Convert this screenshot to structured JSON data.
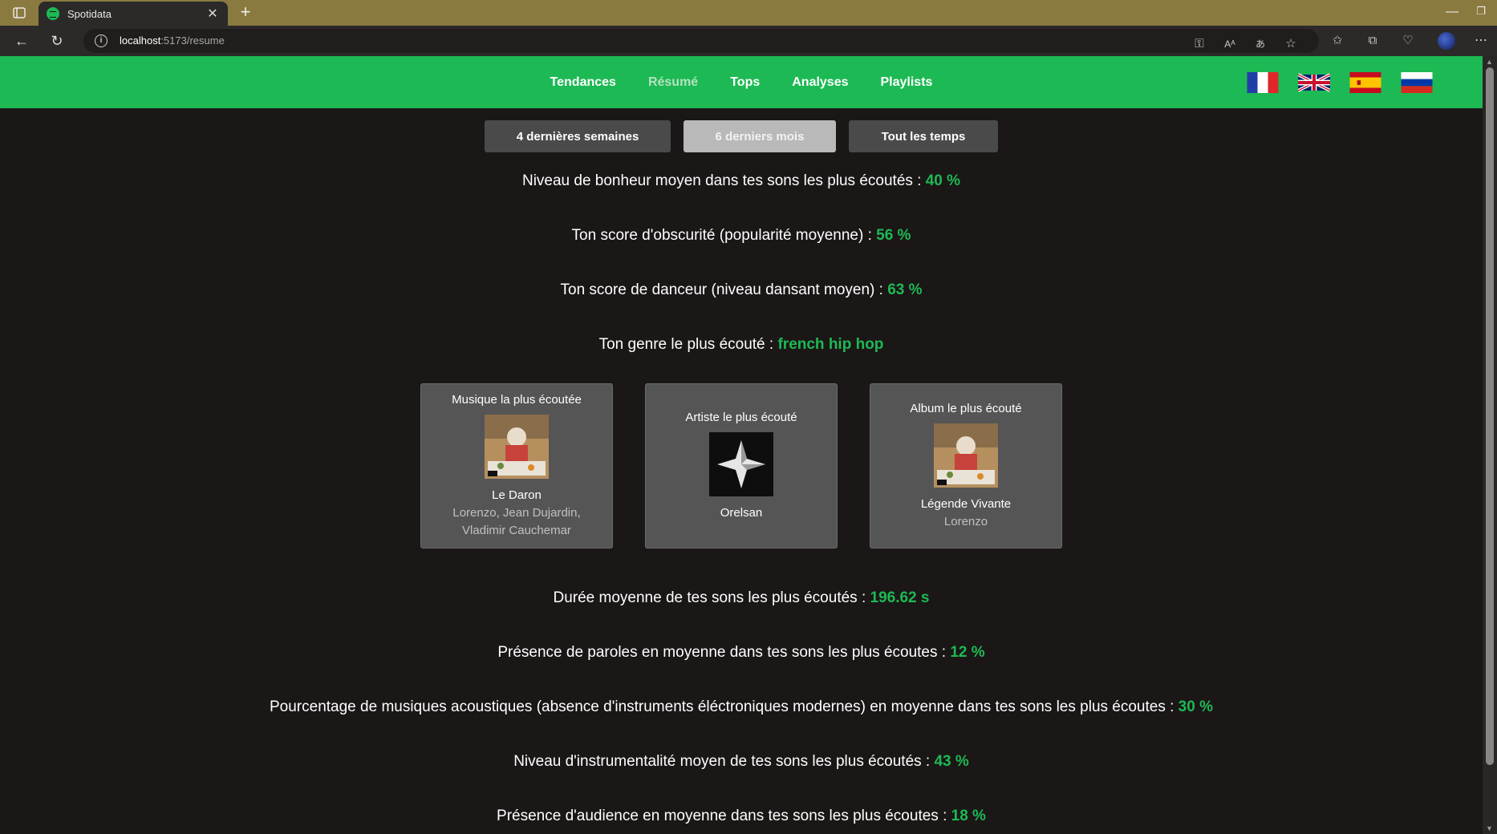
{
  "browser": {
    "tab_title": "Spotidata",
    "url_host": "localhost",
    "url_path": ":5173/resume"
  },
  "nav": {
    "links": [
      "Tendances",
      "Résumé",
      "Tops",
      "Analyses",
      "Playlists"
    ],
    "active": "Résumé"
  },
  "languages": [
    "fr",
    "en",
    "es",
    "ru"
  ],
  "time_ranges": {
    "short": "4 dernières semaines",
    "medium": "6 derniers mois",
    "long": "Tout les temps",
    "active": "medium"
  },
  "stats_top": [
    {
      "label": "Niveau de bonheur moyen dans tes sons les plus écoutés : ",
      "value": "40 %"
    },
    {
      "label": "Ton score d'obscurité (popularité moyenne) : ",
      "value": "56 %"
    },
    {
      "label": "Ton score de danceur (niveau dansant moyen) : ",
      "value": "63 %"
    },
    {
      "label": "Ton genre le plus écouté : ",
      "value": "french hip hop"
    }
  ],
  "cards": {
    "track": {
      "title": "Musique la plus écoutée",
      "name": "Le Daron",
      "sub": "Lorenzo, Jean Dujardin, Vladimir Cauchemar"
    },
    "artist": {
      "title": "Artiste le plus écouté",
      "name": "Orelsan"
    },
    "album": {
      "title": "Album le plus écouté",
      "name": "Légende Vivante",
      "sub": "Lorenzo"
    }
  },
  "stats_bottom": [
    {
      "label": "Durée moyenne de tes sons les plus écoutés : ",
      "value": "196.62 s"
    },
    {
      "label": "Présence de paroles en moyenne dans tes sons les plus écoutes : ",
      "value": "12 %"
    },
    {
      "label": "Pourcentage de musiques acoustiques (absence d'instruments éléctroniques modernes) en moyenne dans tes sons les plus écoutes : ",
      "value": "30 %"
    },
    {
      "label": "Niveau d'instrumentalité moyen de tes sons les plus écoutés : ",
      "value": "43 %"
    },
    {
      "label": "Présence d'audience en moyenne dans tes sons les plus écoutes : ",
      "value": "18 %"
    }
  ],
  "colors": {
    "accent": "#1db954",
    "background": "#1b1717",
    "card": "#555555"
  }
}
